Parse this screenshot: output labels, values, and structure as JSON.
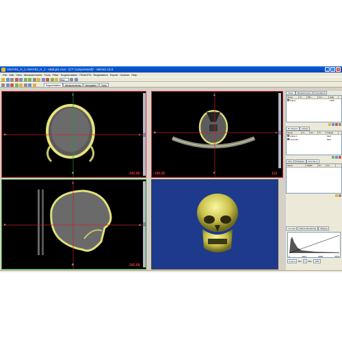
{
  "window": {
    "title": "ANAY01_H_1 ANAY01_H_1 - skull.pt1.mcs - [CT Compressed]* - Mimics 13.0"
  },
  "menu": {
    "items": [
      "File",
      "Edit",
      "View",
      "Measurements",
      "Tools",
      "Filter",
      "Segmentation",
      "FEA/CFD",
      "Registration",
      "Export",
      "Options",
      "Help"
    ]
  },
  "toolbar": {
    "zoom_value": "Box",
    "tabs": [
      "Segmentation",
      "Measurements",
      "Navigation",
      "Tools"
    ],
    "active_tab": "Segmentation"
  },
  "viewports": {
    "coronal": {
      "label_top": "T",
      "label_bottom": "B",
      "label_left": "R",
      "label_right": "L",
      "slice_value": "242.08"
    },
    "axial": {
      "label_top": "A",
      "label_bottom": "P",
      "label_left": "R",
      "label_right": "L",
      "coord_left": "-196.08",
      "coord_right": "113"
    },
    "sagittal": {
      "label_top": "T",
      "label_bottom": "B",
      "label_left": "P",
      "label_right": "A",
      "slice_value": "242.08"
    }
  },
  "right_panel": {
    "masks": {
      "tabs": [
        "Masks",
        "Measurements",
        "Annotations"
      ],
      "active_tab": "Masks",
      "columns": [
        "Name",
        "Vi...",
        "Min...",
        "Lim...",
        "High"
      ],
      "rows": [
        {
          "name": "Yellow",
          "min": "",
          "max": "1290",
          "color": "#e8e05a"
        }
      ]
    },
    "objects": {
      "tabs": [
        "3D Objects",
        "Curves"
      ],
      "active_tab": "3D Objects",
      "columns": [
        "Name",
        "Vi...",
        "Co...",
        "Tr...",
        "Transp"
      ],
      "rows": [
        {
          "name": "Yellow 1",
          "transp": "Med",
          "color": "#e8e05a"
        },
        {
          "name": "mimicsfor",
          "transp": "Med",
          "color": "#e8e05a"
        }
      ]
    },
    "stl": {
      "tabs": [
        "STLs",
        "Polylines",
        "FEA Mesh"
      ],
      "active_tab": "FEA Mesh",
      "columns": [
        "Name",
        "Visible",
        "M...",
        "Co..."
      ]
    },
    "contrast": {
      "tabs": [
        "Contrast",
        "Volume Rendering",
        "Clipping"
      ],
      "active_tab": "Contrast",
      "axis": [
        "0",
        "1024",
        "2048",
        "3072"
      ],
      "preset": "Custom",
      "min_label": "Min:",
      "min_value": "0",
      "max_label": "Max:",
      "max_value": "3000"
    }
  }
}
